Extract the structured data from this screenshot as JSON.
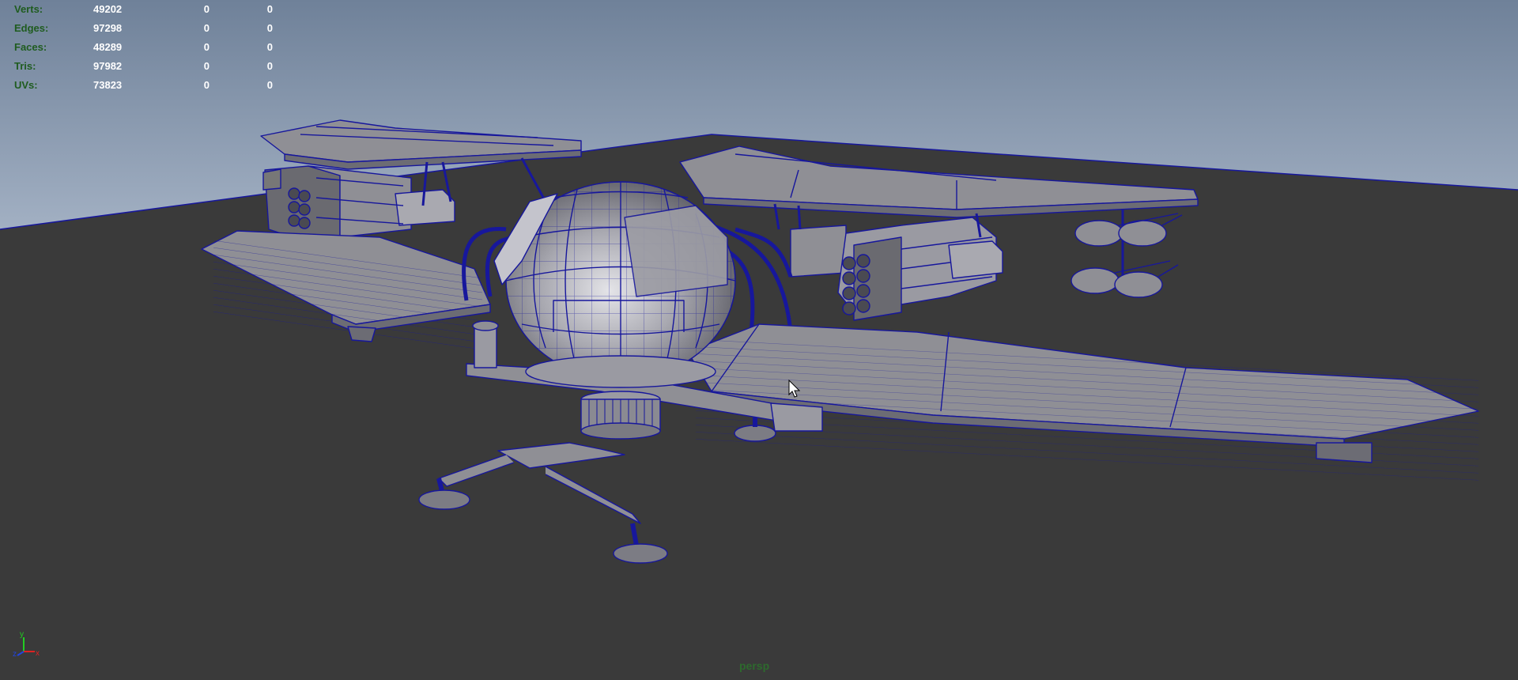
{
  "hud": {
    "rows": [
      {
        "label": "Verts:",
        "value": "49202",
        "a": "0",
        "b": "0"
      },
      {
        "label": "Edges:",
        "value": "97298",
        "a": "0",
        "b": "0"
      },
      {
        "label": "Faces:",
        "value": "48289",
        "a": "0",
        "b": "0"
      },
      {
        "label": "Tris:",
        "value": "97982",
        "a": "0",
        "b": "0"
      },
      {
        "label": "UVs:",
        "value": "73823",
        "a": "0",
        "b": "0"
      }
    ]
  },
  "camera": {
    "name": "persp"
  },
  "axis": {
    "x": "x",
    "y": "y",
    "z": "z"
  },
  "colors": {
    "sky_top": "#7a8aa2",
    "sky_bottom": "#8c9cb4",
    "ground": "#3a3a3a",
    "wire": "#17179c",
    "surface": "#8f8f95",
    "hud_label": "#1f5c1f",
    "hud_value": "#ffffff",
    "camera_label": "#2d6a2d"
  }
}
